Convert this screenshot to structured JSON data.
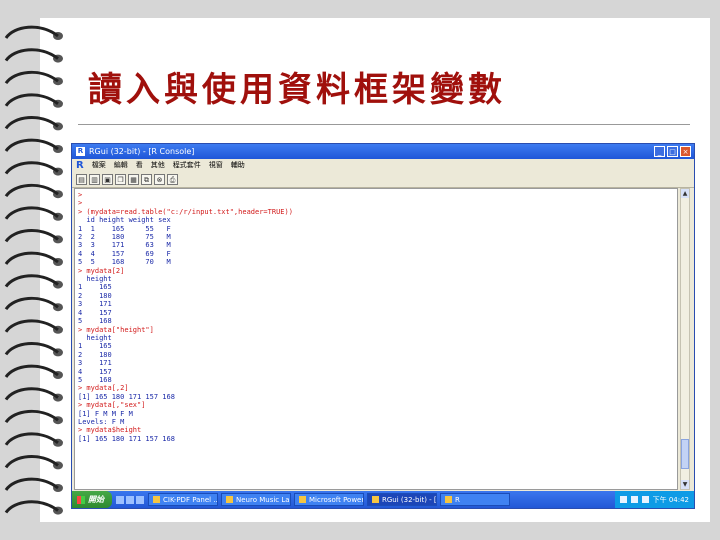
{
  "slide": {
    "title": "讀入與使用資料框架變數"
  },
  "window": {
    "title": "RGui (32-bit) - [R Console]",
    "controls": [
      "_",
      "□",
      "×"
    ]
  },
  "menu": {
    "items": [
      "檔案",
      "編輯",
      "看",
      "其他",
      "程式套件",
      "視窗",
      "輔助"
    ]
  },
  "toolbar": {
    "icons": [
      "open-icon",
      "load-icon",
      "save-icon",
      "copy-icon",
      "paste-icon",
      "copy-paste-icon",
      "stop-icon",
      "print-icon"
    ]
  },
  "console": {
    "lines": [
      {
        "t": "in",
        "s": ">"
      },
      {
        "t": "in",
        "s": ">"
      },
      {
        "t": "in",
        "s": "> (mydata=read.table(\"c:/r/input.txt\",header=TRUE))"
      },
      {
        "t": "out",
        "s": "  id height weight sex"
      },
      {
        "t": "out",
        "s": "1  1    165     55   F"
      },
      {
        "t": "out",
        "s": "2  2    180     75   M"
      },
      {
        "t": "out",
        "s": "3  3    171     63   M"
      },
      {
        "t": "out",
        "s": "4  4    157     69   F"
      },
      {
        "t": "out",
        "s": "5  5    168     70   M"
      },
      {
        "t": "in",
        "s": "> mydata[2]"
      },
      {
        "t": "out",
        "s": "  height"
      },
      {
        "t": "out",
        "s": "1    165"
      },
      {
        "t": "out",
        "s": "2    180"
      },
      {
        "t": "out",
        "s": "3    171"
      },
      {
        "t": "out",
        "s": "4    157"
      },
      {
        "t": "out",
        "s": "5    168"
      },
      {
        "t": "in",
        "s": "> mydata[\"height\"]"
      },
      {
        "t": "out",
        "s": "  height"
      },
      {
        "t": "out",
        "s": "1    165"
      },
      {
        "t": "out",
        "s": "2    180"
      },
      {
        "t": "out",
        "s": "3    171"
      },
      {
        "t": "out",
        "s": "4    157"
      },
      {
        "t": "out",
        "s": "5    168"
      },
      {
        "t": "in",
        "s": "> mydata[,2]"
      },
      {
        "t": "out",
        "s": "[1] 165 180 171 157 168"
      },
      {
        "t": "in",
        "s": "> mydata[,\"sex\"]"
      },
      {
        "t": "out",
        "s": "[1] F M M F M"
      },
      {
        "t": "out",
        "s": "Levels: F M"
      },
      {
        "t": "in",
        "s": "> mydata$height"
      },
      {
        "t": "out",
        "s": "[1] 165 180 171 157 168"
      }
    ]
  },
  "taskbar": {
    "start_label": "開始",
    "tasks": [
      {
        "label": "CIK-PDF Panel ..."
      },
      {
        "label": "Neuro Music Lab..."
      },
      {
        "label": "Microsoft Power..."
      },
      {
        "label": "RGui (32-bit) - [..."
      },
      {
        "label": "R"
      }
    ],
    "clock": "下午 04:42"
  }
}
